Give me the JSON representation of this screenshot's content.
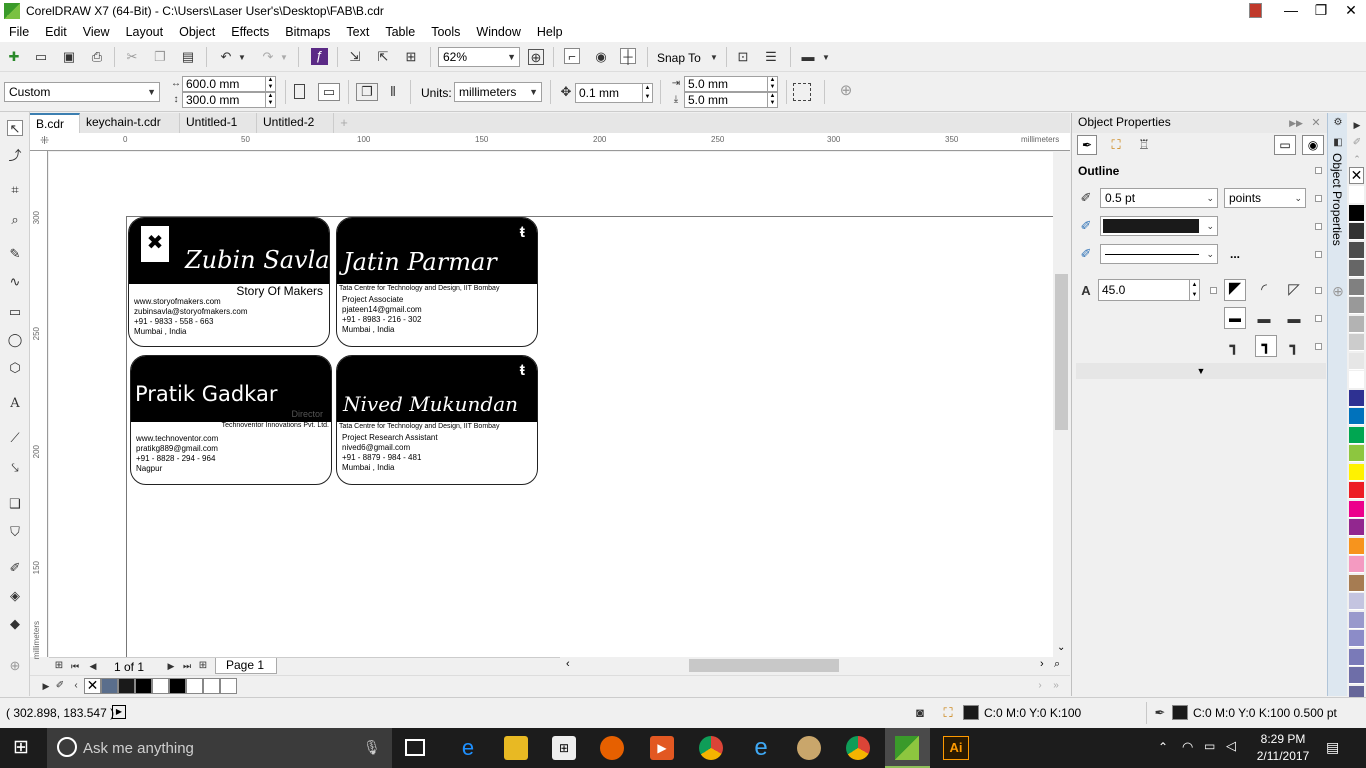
{
  "window": {
    "title": "CorelDRAW X7 (64-Bit) - C:\\Users\\Laser User's\\Desktop\\FAB\\B.cdr",
    "minimize": "—",
    "maximize": "❐",
    "close": "✕"
  },
  "menu": [
    "File",
    "Edit",
    "View",
    "Layout",
    "Object",
    "Effects",
    "Bitmaps",
    "Text",
    "Table",
    "Tools",
    "Window",
    "Help"
  ],
  "standard_toolbar": {
    "zoom_level": "62%",
    "snap_to_label": "Snap To"
  },
  "property_bar": {
    "page_size_preset": "Custom",
    "page_width": "600.0 mm",
    "page_height": "300.0 mm",
    "units_label": "Units:",
    "units_value": "millimeters",
    "nudge_distance": "0.1 mm",
    "duplicate_x": "5.0 mm",
    "duplicate_y": "5.0 mm"
  },
  "document_tabs": [
    {
      "label": "B.cdr",
      "active": true
    },
    {
      "label": "keychain-t.cdr",
      "active": false
    },
    {
      "label": "Untitled-1",
      "active": false
    },
    {
      "label": "Untitled-2",
      "active": false
    }
  ],
  "horizontal_ruler": {
    "ticks": [
      "0",
      "50",
      "100",
      "150",
      "200",
      "250",
      "300",
      "350"
    ],
    "unit": "millimeters"
  },
  "vertical_ruler": {
    "ticks": [
      "300",
      "250",
      "200",
      "150"
    ],
    "unit": "millimeters"
  },
  "cards": [
    {
      "name": "Zubin Savla",
      "subtitle": "Story Of Makers",
      "lines": [
        "www.storyofmakers.com",
        "zubinsavla@storyofmakers.com",
        "+91 - 9833 - 558 - 663",
        "Mumbai , India"
      ]
    },
    {
      "name": "Jatin Parmar",
      "subtitle": "Tata Centre for Technology and Design, IIT Bombay",
      "lines": [
        "Project Associate",
        "pjateen14@gmail.com",
        "+91 - 8983 - 216 - 302",
        "Mumbai , India"
      ]
    },
    {
      "name": "Pratik Gadkar",
      "subtitle": "Technoventor Innovations Pvt. Ltd.",
      "tag": "Director",
      "lines": [
        "www.technoventor.com",
        "pratikg889@gmail.com",
        "+91 - 8828 - 294 - 964",
        "Nagpur"
      ]
    },
    {
      "name": "Nived Mukundan",
      "subtitle": "Tata Centre for Technology and Design, IIT Bombay",
      "lines": [
        "Project Research Assistant",
        "nived6@gmail.com",
        "+91 - 8879 - 984 - 481",
        "Mumbai , India"
      ]
    }
  ],
  "page_navigator": {
    "page_count": "1 of 1",
    "page_tab": "Page 1"
  },
  "object_properties": {
    "title": "Object Properties",
    "section": "Outline",
    "outline_width": "0.5 pt",
    "outline_units": "points",
    "outline_color": "#1a1a1a",
    "more": "...",
    "miter_limit": "45.0",
    "side_tab": "Object Properties"
  },
  "color_palette": [
    "#ffffff",
    "#000000",
    "#333333",
    "#4d4d4d",
    "#666666",
    "#808080",
    "#999999",
    "#b3b3b3",
    "#cccccc",
    "#e6e6e6",
    "#ffffff",
    "#2e3192",
    "#0072bc",
    "#00a651",
    "#8dc63f",
    "#fff200",
    "#ed1c24",
    "#ec008c",
    "#92278f",
    "#f7941d",
    "#f49ac1",
    "#a67c52",
    "#c4c4e0",
    "#9999cc",
    "#8c8cc8",
    "#7a7ab8",
    "#6e6ea8",
    "#666699"
  ],
  "document_palette": [
    "#5a6e8c",
    "#1a1a1a",
    "#000000",
    "#ffffff",
    "#000000",
    "#ffffff",
    "#ffffff",
    "#ffffff"
  ],
  "status": {
    "coordinates": "( 302.898, 183.547 )",
    "fill_color_text": "C:0 M:0 Y:0 K:100",
    "outline_color_text": "C:0 M:0 Y:0 K:100  0.500 pt"
  },
  "taskbar": {
    "search_placeholder": "Ask me anything",
    "time": "8:29 PM",
    "date": "2/11/2017"
  }
}
